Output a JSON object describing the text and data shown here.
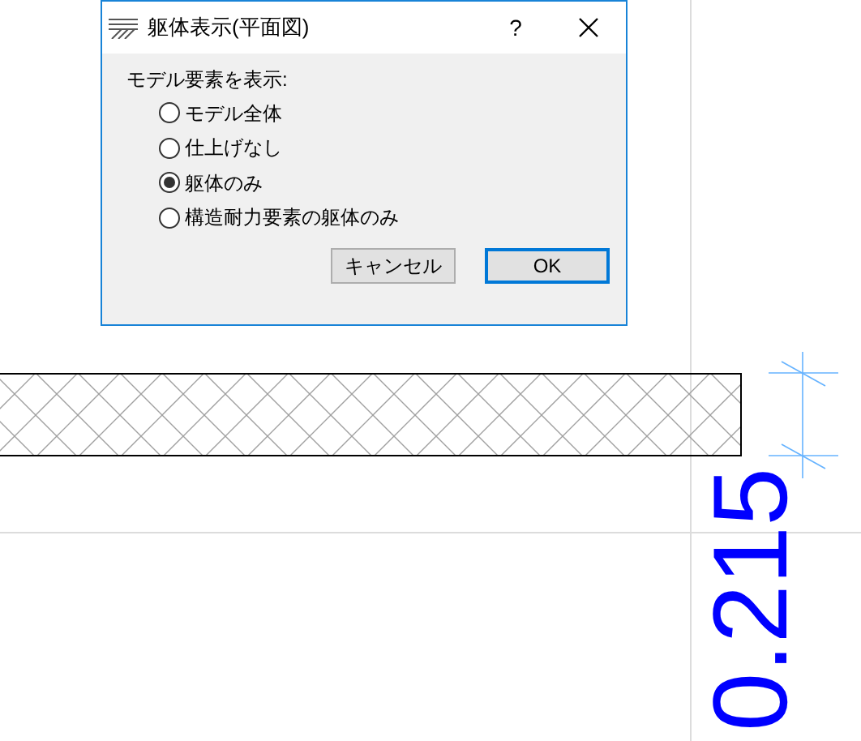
{
  "dialog": {
    "title": "躯体表示(平面図)",
    "help": "?",
    "group_label": "モデル要素を表示:",
    "options": [
      {
        "label": "モデル全体",
        "selected": false
      },
      {
        "label": "仕上げなし",
        "selected": false
      },
      {
        "label": "躯体のみ",
        "selected": true
      },
      {
        "label": "構造耐力要素の躯体のみ",
        "selected": false
      }
    ],
    "buttons": [
      {
        "label": "キャンセル",
        "default": false
      },
      {
        "label": "OK",
        "default": true
      }
    ]
  },
  "drawing": {
    "dimension": "0.215"
  }
}
